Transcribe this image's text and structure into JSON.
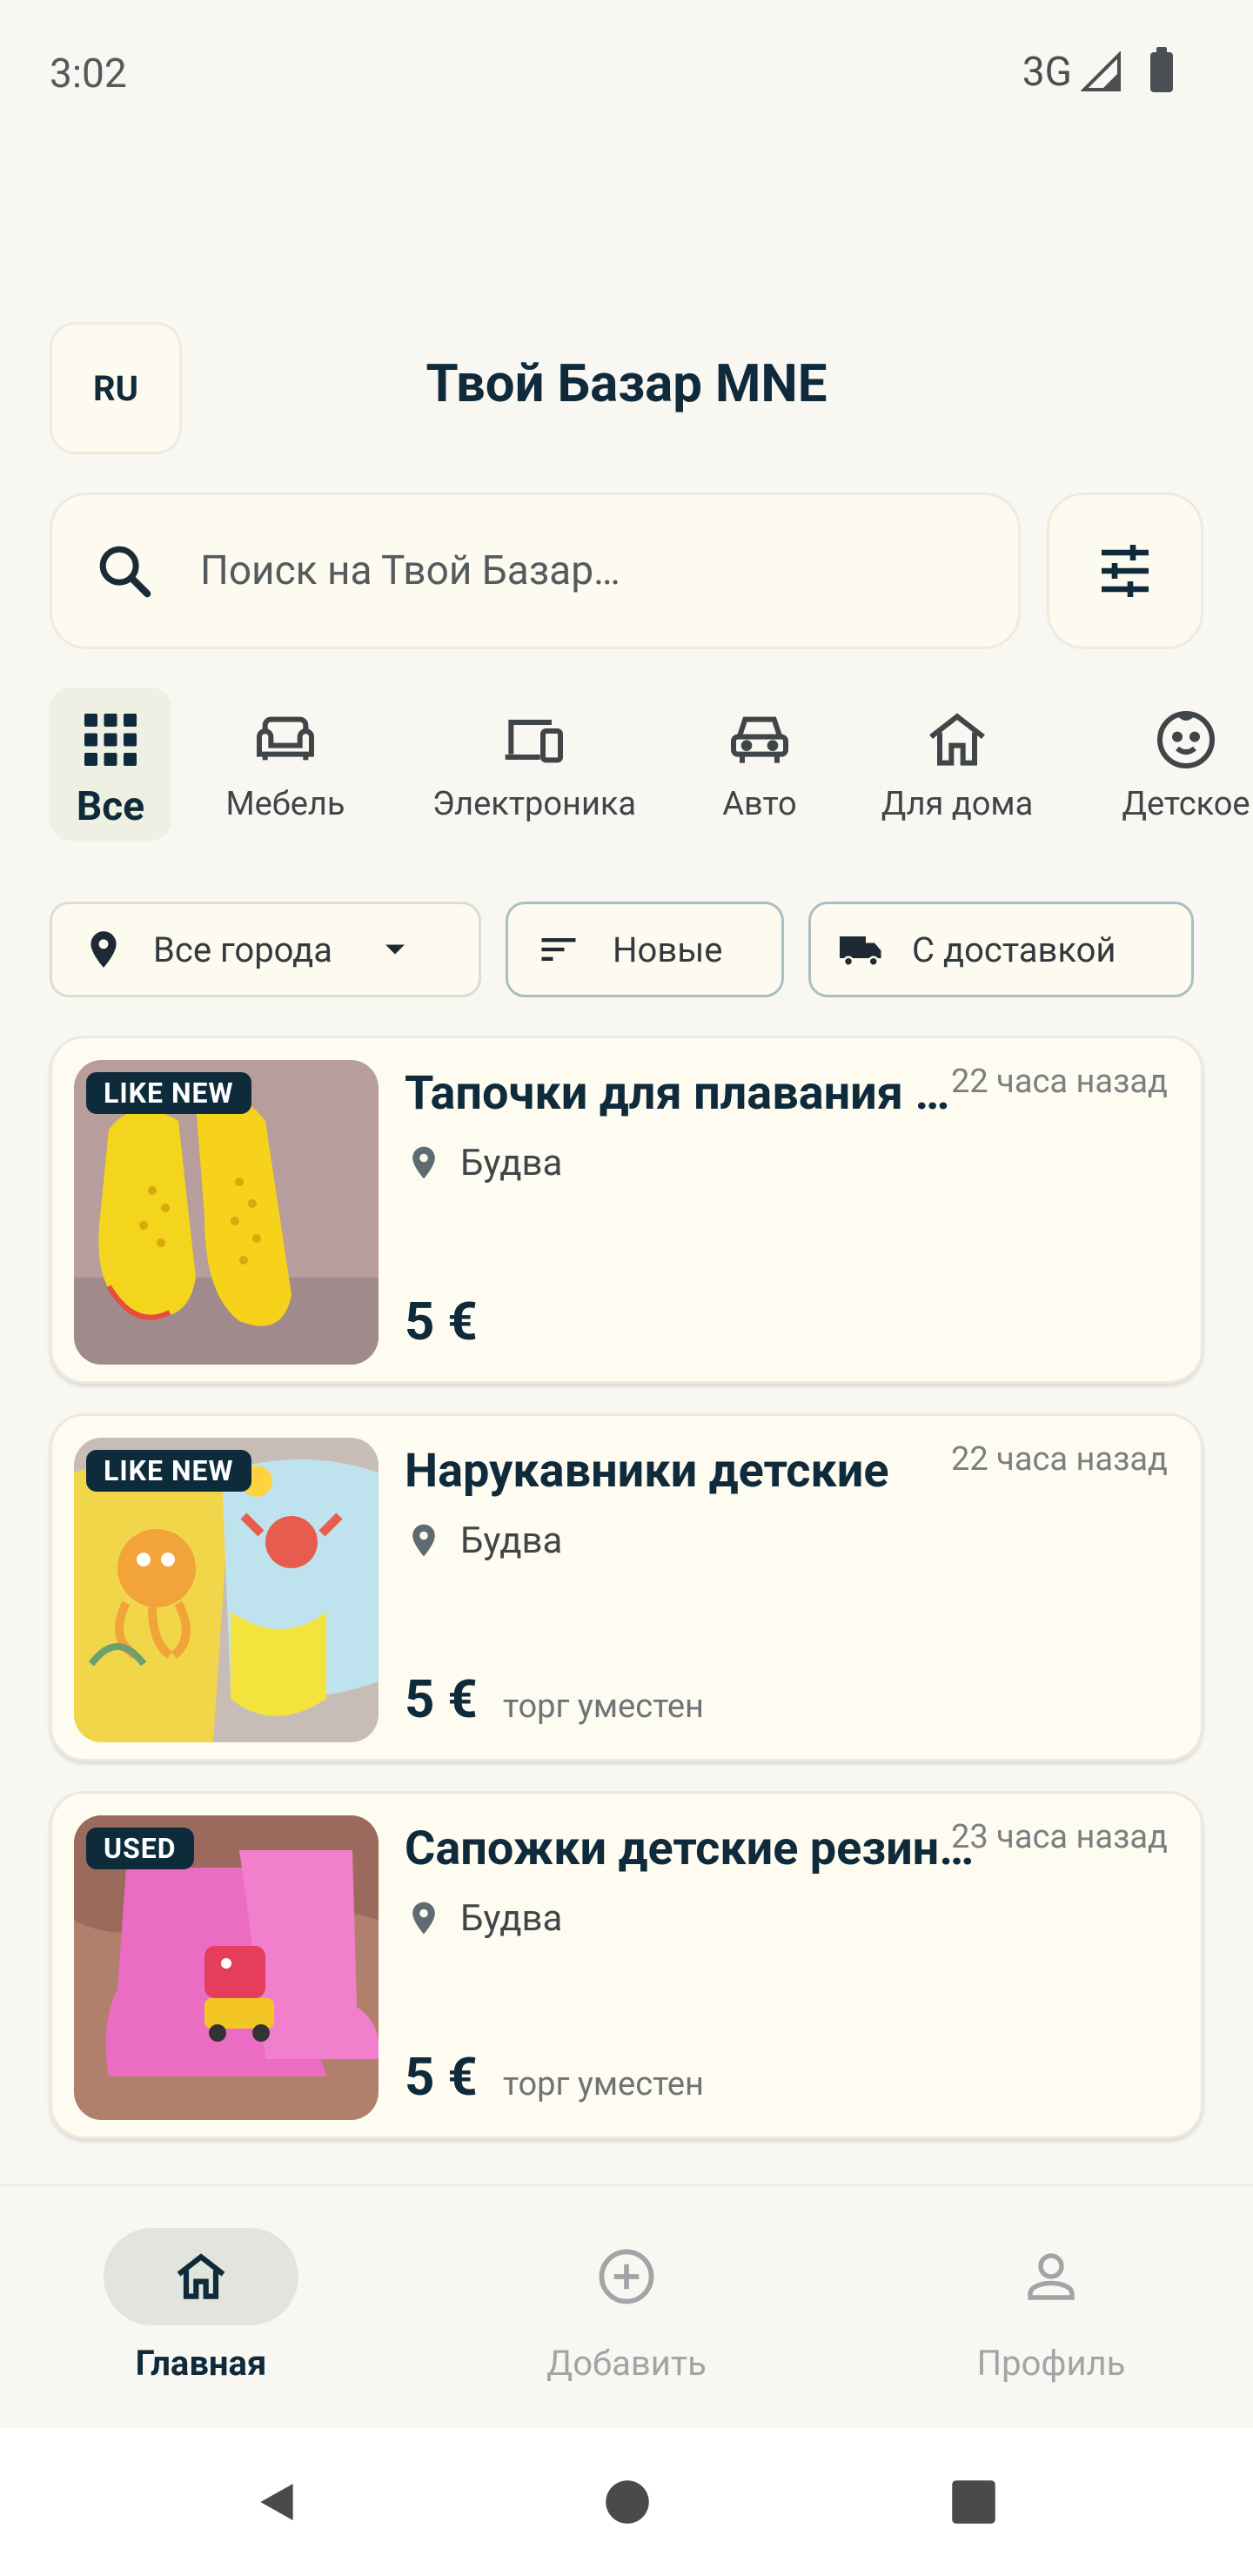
{
  "status_bar": {
    "time": "3:02",
    "network": "3G"
  },
  "header": {
    "language": "RU",
    "title": "Твой Базар MNE"
  },
  "search": {
    "placeholder": "Поиск на Твой Базар…"
  },
  "categories": [
    {
      "label": "Все",
      "icon": "grid-icon",
      "active": true
    },
    {
      "label": "Мебель",
      "icon": "sofa-icon"
    },
    {
      "label": "Электроника",
      "icon": "devices-icon"
    },
    {
      "label": "Авто",
      "icon": "car-icon"
    },
    {
      "label": "Для дома",
      "icon": "house-icon"
    },
    {
      "label": "Детское",
      "icon": "baby-face-icon"
    }
  ],
  "filters": {
    "city": "Все города",
    "sort": "Новые",
    "delivery": "С доставкой"
  },
  "listings": [
    {
      "badge": "LIKE NEW",
      "title": "Тапочки для плавания детские",
      "time": "22 часа назад",
      "location": "Будва",
      "price": "5 €",
      "negotiable": ""
    },
    {
      "badge": "LIKE NEW",
      "title": "Нарукавники детские",
      "time": "22 часа назад",
      "location": "Будва",
      "price": "5 €",
      "negotiable": "торг уместен"
    },
    {
      "badge": "USED",
      "title": "Сапожки детские резиновые",
      "time": "23 часа назад",
      "location": "Будва",
      "price": "5 €",
      "negotiable": "торг уместен"
    }
  ],
  "bottom_nav": [
    {
      "label": "Главная",
      "icon": "home-icon",
      "active": true
    },
    {
      "label": "Добавить",
      "icon": "add-circle-icon"
    },
    {
      "label": "Профиль",
      "icon": "person-icon"
    }
  ],
  "colors": {
    "primary": "#0f2a3a",
    "background": "#f8f7f2",
    "card": "#fefcf0",
    "accent_outline": "#a9bfc2"
  }
}
